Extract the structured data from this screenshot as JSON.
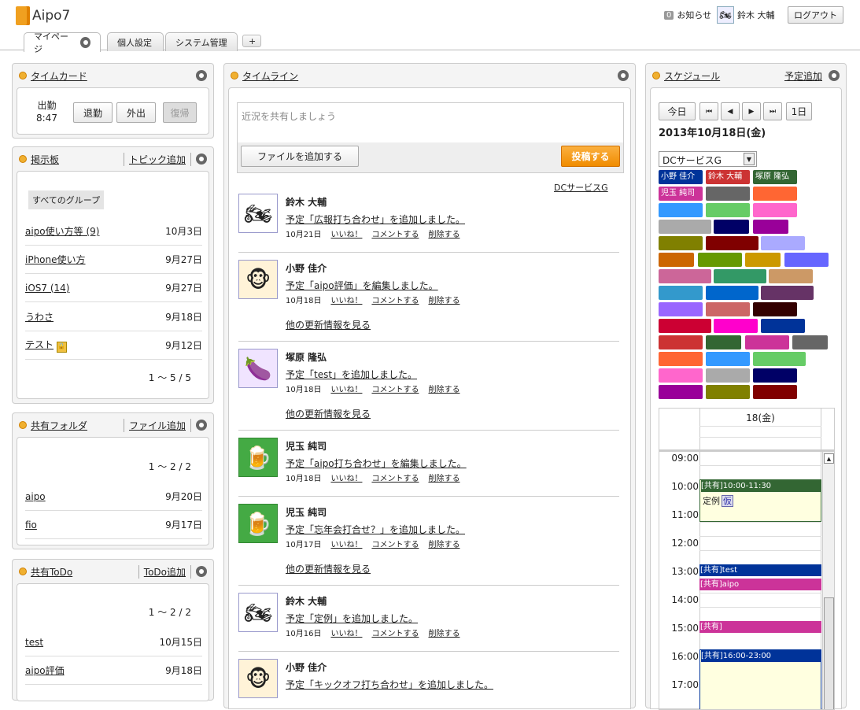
{
  "app": {
    "logo": "Aipo7",
    "notice_count": "0",
    "notice": "お知らせ",
    "user": "鈴木 大輔",
    "logout": "ログアウト"
  },
  "tabs": [
    {
      "label": "マイページ"
    },
    {
      "label": "個人設定"
    },
    {
      "label": "システム管理"
    },
    {
      "label": "+"
    }
  ],
  "timecard": {
    "title": "タイムカード",
    "status": "出勤",
    "time": "8:47",
    "btn1": "退勤",
    "btn2": "外出",
    "btn3": "復帰"
  },
  "board": {
    "title": "掲示板",
    "action": "トピック追加",
    "group": "すべてのグループ",
    "rows": [
      {
        "t": "aipo使い方等 (9)",
        "d": "10月3日"
      },
      {
        "t": "iPhone使い方",
        "d": "9月27日"
      },
      {
        "t": "iOS7 (14)",
        "d": "9月27日"
      },
      {
        "t": "うわさ",
        "d": "9月18日"
      },
      {
        "t": "テスト",
        "d": "9月12日"
      }
    ],
    "paging": "1 ～ 5 / 5"
  },
  "folder": {
    "title": "共有フォルダ",
    "action": "ファイル追加",
    "paging": "1 ～ 2 / 2",
    "rows": [
      {
        "t": "aipo",
        "d": "9月20日"
      },
      {
        "t": "fio",
        "d": "9月17日"
      }
    ]
  },
  "todo": {
    "title": "共有ToDo",
    "action": "ToDo追加",
    "paging": "1 ～ 2 / 2",
    "rows": [
      {
        "t": "test",
        "d": "10月15日"
      },
      {
        "t": "aipo評価",
        "d": "9月18日"
      }
    ]
  },
  "timeline": {
    "title": "タイムライン",
    "placeholder": "近況を共有しましょう",
    "file_btn": "ファイルを追加する",
    "post_btn": "投稿する",
    "group_link": "DCサービスG",
    "like": "いいね！",
    "comment": "コメントする",
    "delete": "削除する",
    "more": "他の更新情報を見る",
    "items": [
      {
        "name": "鈴木 大輔",
        "msg": "予定「広報打ち合わせ」を追加しました。",
        "date": "10月21日",
        "icon": "motorcycle-icon"
      },
      {
        "name": "小野 佳介",
        "msg": "予定「aipo評価」を編集しました。",
        "date": "10月18日",
        "icon": "monkey-icon"
      },
      {
        "name": "塚原 隆弘",
        "msg": "予定「test」を追加しました。",
        "date": "10月18日",
        "icon": "eggplant-icon"
      },
      {
        "name": "児玉 純司",
        "msg": "予定「aipo打ち合わせ」を編集しました。",
        "date": "10月18日",
        "icon": "beer-icon"
      },
      {
        "name": "児玉 純司",
        "msg": "予定「忘年会打合せ？」を追加しました。",
        "date": "10月17日",
        "icon": "beer-icon"
      },
      {
        "name": "鈴木 大輔",
        "msg": "予定「定例」を追加しました。",
        "date": "10月16日",
        "icon": "motorcycle-icon"
      },
      {
        "name": "小野 佳介",
        "msg": "予定「キックオフ打ち合わせ」を追加しました。",
        "date": "",
        "icon": "monkey-icon"
      }
    ]
  },
  "schedule": {
    "title": "スケジュール",
    "action": "予定追加",
    "today": "今日",
    "day": "1日",
    "date": "2013年10月18日(金)",
    "group": "DCサービスG",
    "members": [
      "小野 佳介",
      "鈴木 大輔",
      "塚原 隆弘",
      "児玉 純司"
    ],
    "colhead": "18(金)",
    "hours": [
      "09:00",
      "10:00",
      "11:00",
      "12:00",
      "13:00",
      "14:00",
      "15:00",
      "16:00",
      "17:00"
    ],
    "events": [
      {
        "label": "[共有]10:00-11:30",
        "sub": "定例",
        "tag": "仮"
      },
      {
        "label": "[共有]test"
      },
      {
        "label": "[共有]aipo"
      },
      {
        "label": "[共有]"
      },
      {
        "label": "[共有]16:00-23:00"
      }
    ]
  }
}
